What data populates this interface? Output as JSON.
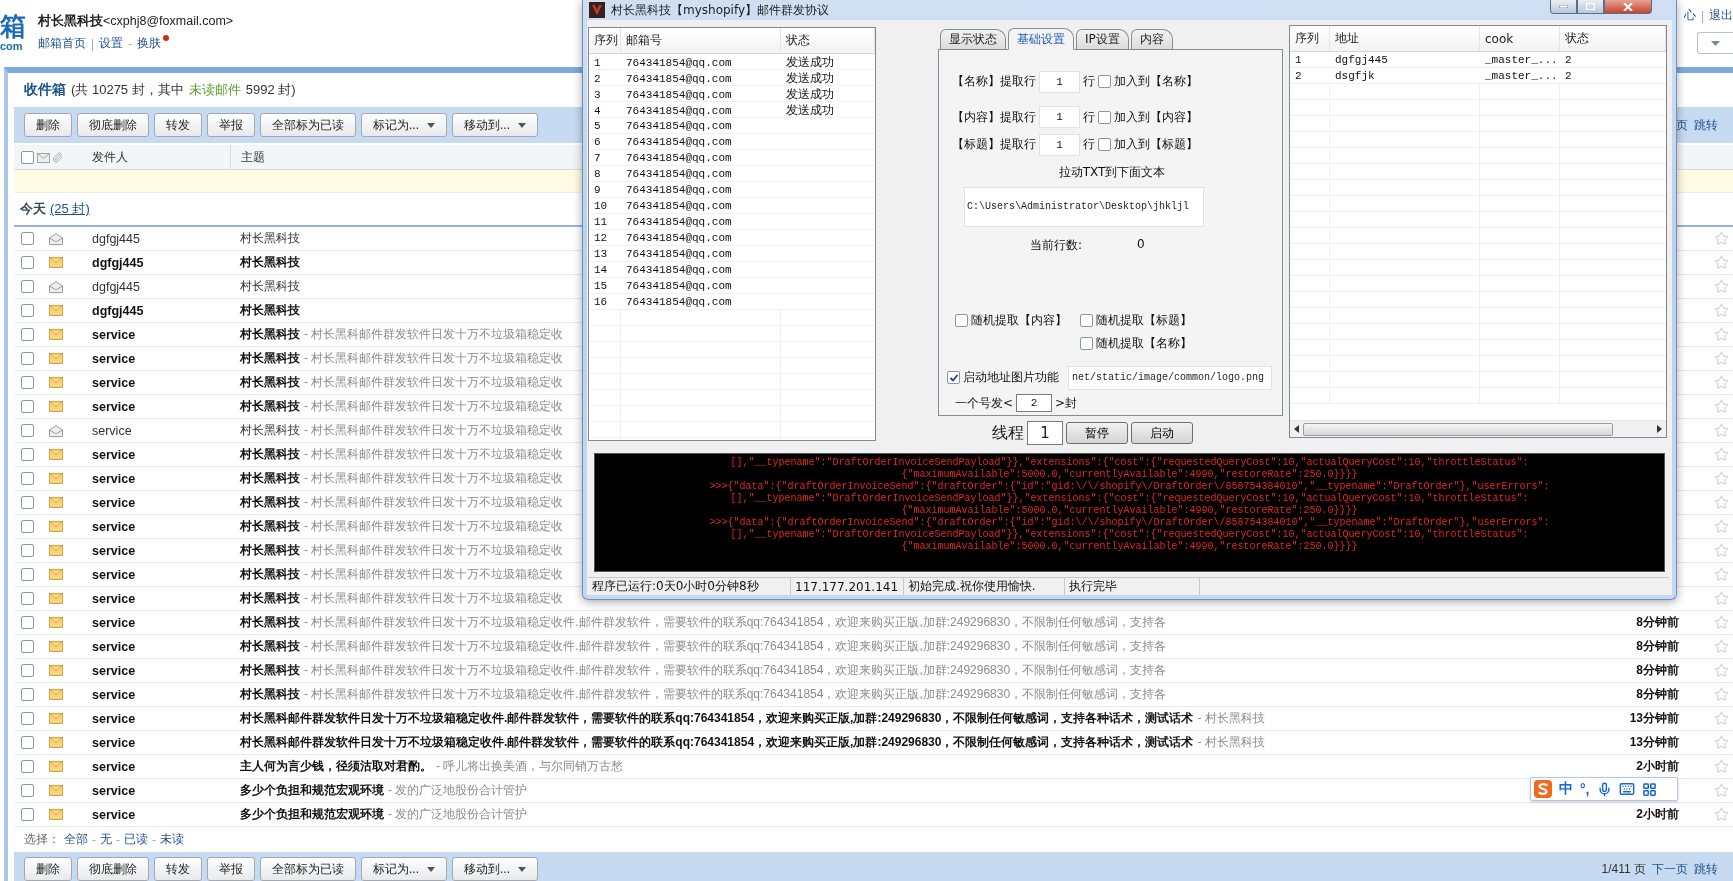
{
  "mail": {
    "logo": "箱",
    "logo_sub": "com",
    "user": "**村长黑科技**<cxphj8@foxmail.com>",
    "header_links": [
      {
        "kind": "link",
        "text": "邮箱首页"
      },
      {
        "kind": "separator",
        "text": "|"
      },
      {
        "kind": "link",
        "text": "设置"
      },
      {
        "kind": "separator",
        "text": "-"
      },
      {
        "kind": "link",
        "text": "换肤",
        "dot": true
      }
    ],
    "top_right_links": [
      {
        "kind": "link",
        "text": "心"
      },
      {
        "kind": "separator",
        "text": "|"
      },
      {
        "kind": "link",
        "text": "退出"
      }
    ],
    "folder": {
      "name": "收件箱",
      "before": "(共 10275 封，其中",
      "unread_label": "未读邮件",
      "after": "5992 封)"
    },
    "toolbar": [
      {
        "label": "删除",
        "kind": "button"
      },
      {
        "label": "彻底删除",
        "kind": "button"
      },
      {
        "label": "转发",
        "kind": "button"
      },
      {
        "label": "举报",
        "kind": "button"
      },
      {
        "label": "全部标为已读",
        "kind": "button"
      },
      {
        "label": "标记为...",
        "kind": "menu"
      },
      {
        "label": "移动到...",
        "kind": "menu"
      }
    ],
    "toolbar_links": [
      "页",
      "跳转"
    ],
    "select_all": {
      "checked": false
    },
    "columns": [
      "发件人",
      "主题"
    ],
    "group": {
      "label": "今天",
      "count": "(25 封)"
    },
    "rows": [
      {
        "sender": "dgfgj445",
        "unread": false,
        "checked": false,
        "starred": false,
        "subject": "村长黑科技"
      },
      {
        "sender": "dgfgj445",
        "unread": true,
        "checked": false,
        "starred": false,
        "subject": "村长黑科技"
      },
      {
        "sender": "dgfgj445",
        "unread": false,
        "checked": false,
        "starred": false,
        "subject": "村长黑科技"
      },
      {
        "sender": "dgfgj445",
        "unread": true,
        "checked": false,
        "starred": false,
        "subject": "村长黑科技"
      },
      {
        "sender": "service",
        "unread": true,
        "checked": false,
        "starred": false,
        "subject": "村长黑科技",
        "preview": "- 村长黑科邮件群发软件日发十万不垃圾箱稳定收"
      },
      {
        "sender": "service",
        "unread": true,
        "checked": false,
        "starred": false,
        "subject": "村长黑科技",
        "preview": "- 村长黑科邮件群发软件日发十万不垃圾箱稳定收"
      },
      {
        "sender": "service",
        "unread": true,
        "checked": false,
        "starred": false,
        "subject": "村长黑科技",
        "preview": "- 村长黑科邮件群发软件日发十万不垃圾箱稳定收"
      },
      {
        "sender": "service",
        "unread": true,
        "checked": false,
        "starred": false,
        "subject": "村长黑科技",
        "preview": "- 村长黑科邮件群发软件日发十万不垃圾箱稳定收"
      },
      {
        "sender": "service",
        "unread": false,
        "checked": false,
        "starred": false,
        "subject": "村长黑科技",
        "preview": "- 村长黑科邮件群发软件日发十万不垃圾箱稳定收"
      },
      {
        "sender": "service",
        "unread": true,
        "checked": false,
        "starred": false,
        "subject": "村长黑科技",
        "preview": "- 村长黑科邮件群发软件日发十万不垃圾箱稳定收"
      },
      {
        "sender": "service",
        "unread": true,
        "checked": false,
        "starred": false,
        "subject": "村长黑科技",
        "preview": "- 村长黑科邮件群发软件日发十万不垃圾箱稳定收"
      },
      {
        "sender": "service",
        "unread": true,
        "checked": false,
        "starred": false,
        "subject": "村长黑科技",
        "preview": "- 村长黑科邮件群发软件日发十万不垃圾箱稳定收"
      },
      {
        "sender": "service",
        "unread": true,
        "checked": false,
        "starred": false,
        "subject": "村长黑科技",
        "preview": "- 村长黑科邮件群发软件日发十万不垃圾箱稳定收"
      },
      {
        "sender": "service",
        "unread": true,
        "checked": false,
        "starred": false,
        "subject": "村长黑科技",
        "preview": "- 村长黑科邮件群发软件日发十万不垃圾箱稳定收"
      },
      {
        "sender": "service",
        "unread": true,
        "checked": false,
        "starred": false,
        "subject": "村长黑科技",
        "preview": "- 村长黑科邮件群发软件日发十万不垃圾箱稳定收"
      },
      {
        "sender": "service",
        "unread": true,
        "checked": false,
        "starred": false,
        "subject": "村长黑科技",
        "preview": "- 村长黑科邮件群发软件日发十万不垃圾箱稳定收"
      },
      {
        "sender": "service",
        "unread": true,
        "checked": false,
        "starred": false,
        "subject": "村长黑科技",
        "preview": "- 村长黑科邮件群发软件日发十万不垃圾箱稳定收件.邮件群发软件，需要软件的联系qq:764341854，欢迎来购买正版,加群:249296830，不限制任何敏感词，支持各",
        "time": "8分钟前"
      },
      {
        "sender": "service",
        "unread": true,
        "checked": false,
        "starred": false,
        "subject": "村长黑科技",
        "preview": "- 村长黑科邮件群发软件日发十万不垃圾箱稳定收件.邮件群发软件，需要软件的联系qq:764341854，欢迎来购买正版,加群:249296830，不限制任何敏感词，支持各",
        "time": "8分钟前"
      },
      {
        "sender": "service",
        "unread": true,
        "checked": false,
        "starred": false,
        "subject": "村长黑科技",
        "preview": "- 村长黑科邮件群发软件日发十万不垃圾箱稳定收件.邮件群发软件，需要软件的联系qq:764341854，欢迎来购买正版,加群:249296830，不限制任何敏感词，支持各",
        "time": "8分钟前"
      },
      {
        "sender": "service",
        "unread": true,
        "checked": false,
        "starred": false,
        "subject": "村长黑科技",
        "preview": "- 村长黑科邮件群发软件日发十万不垃圾箱稳定收件.邮件群发软件，需要软件的联系qq:764341854，欢迎来购买正版,加群:249296830，不限制任何敏感词，支持各",
        "time": "8分钟前"
      },
      {
        "sender": "service",
        "unread": true,
        "checked": false,
        "starred": false,
        "subject": "村长黑科邮件群发软件日发十万不垃圾箱稳定收件.邮件群发软件，需要软件的联系qq:764341854，欢迎来购买正版,加群:249296830，不限制任何敏感词，支持各种话术，测试话术",
        "preview": "- 村长黑科技",
        "time": "13分钟前"
      },
      {
        "sender": "service",
        "unread": true,
        "checked": false,
        "starred": false,
        "subject": "村长黑科邮件群发软件日发十万不垃圾箱稳定收件.邮件群发软件，需要软件的联系qq:764341854，欢迎来购买正版,加群:249296830，不限制任何敏感词，支持各种话术，测试话术",
        "preview": "- 村长黑科技",
        "time": "13分钟前"
      },
      {
        "sender": "service",
        "unread": true,
        "checked": false,
        "starred": false,
        "subject": "主人何为言少钱，径须沽取对君酌。",
        "preview": "- 呼儿将出换美酒，与尔同销万古愁",
        "time": "2小时前"
      },
      {
        "sender": "service",
        "unread": true,
        "checked": false,
        "starred": false,
        "subject": "多少个负担和规范宏观环境",
        "preview": "- 发的广泛地股份合计管护"
      },
      {
        "sender": "service",
        "unread": true,
        "checked": false,
        "starred": false,
        "subject": "多少个负担和规范宏观环境",
        "preview": "- 发的广泛地股份合计管护",
        "time": "2小时前"
      }
    ],
    "select": {
      "label": "选择：",
      "options": [
        "全部",
        "无",
        "已读",
        "未读"
      ],
      "separator": "-"
    },
    "bottom_toolbar": [
      {
        "label": "删除",
        "kind": "button"
      },
      {
        "label": "彻底删除",
        "kind": "button"
      },
      {
        "label": "转发",
        "kind": "button"
      },
      {
        "label": "举报",
        "kind": "button"
      },
      {
        "label": "全部标为已读",
        "kind": "button"
      },
      {
        "label": "标记为...",
        "kind": "menu"
      },
      {
        "label": "移动到...",
        "kind": "menu"
      }
    ],
    "pager": {
      "page": "1/411 页",
      "links": [
        "下一页",
        "跳转"
      ]
    }
  },
  "app": {
    "title": "村长黑科技【myshopify】邮件群发协议",
    "email_table": {
      "columns": [
        "序列",
        "邮箱号",
        "状态"
      ],
      "rows": [
        {
          "index": "1",
          "email": "764341854@qq.com",
          "status": "发送成功"
        },
        {
          "index": "2",
          "email": "764341854@qq.com",
          "status": "发送成功"
        },
        {
          "index": "3",
          "email": "764341854@qq.com",
          "status": "发送成功"
        },
        {
          "index": "4",
          "email": "764341854@qq.com",
          "status": "发送成功"
        },
        {
          "index": "5",
          "email": "764341854@qq.com"
        },
        {
          "index": "6",
          "email": "764341854@qq.com"
        },
        {
          "index": "7",
          "email": "764341854@qq.com"
        },
        {
          "index": "8",
          "email": "764341854@qq.com"
        },
        {
          "index": "9",
          "email": "764341854@qq.com"
        },
        {
          "index": "10",
          "email": "764341854@qq.com"
        },
        {
          "index": "11",
          "email": "764341854@qq.com"
        },
        {
          "index": "12",
          "email": "764341854@qq.com"
        },
        {
          "index": "13",
          "email": "764341854@qq.com"
        },
        {
          "index": "14",
          "email": "764341854@qq.com"
        },
        {
          "index": "15",
          "email": "764341854@qq.com"
        },
        {
          "index": "16",
          "email": "764341854@qq.com"
        }
      ]
    },
    "tabs": [
      {
        "label": "显示状态",
        "selected": false
      },
      {
        "label": "基础设置",
        "selected": true
      },
      {
        "label": "IP设置",
        "selected": false
      },
      {
        "label": "内容",
        "selected": false
      }
    ],
    "extract_rows": [
      {
        "label": "【名称】提取行",
        "value": "1",
        "unit": "行",
        "checkbox_label": "加入到【名称】",
        "checked": false
      },
      {
        "label": "【内容】提取行",
        "value": "1",
        "unit": "行",
        "checkbox_label": "加入到【内容】",
        "checked": false
      },
      {
        "label": "【标题】提取行",
        "value": "1",
        "unit": "行",
        "checkbox_label": "加入到【标题】",
        "checked": false
      }
    ],
    "drag_hint": "拉动TXT到下面文本",
    "path": "C:\\Users\\Administrator\\Desktop\\jhkljl",
    "line_count_label": "当前行数:",
    "line_count": "0",
    "random_options": [
      {
        "label": "随机提取【内容】",
        "checked": false
      },
      {
        "label": "随机提取【标题】",
        "checked": false
      },
      {
        "label": "随机提取【名称】",
        "checked": false
      }
    ],
    "image_feature": {
      "label": "启动地址图片功能",
      "checked": true,
      "value": "net/static/image/common/logo.png"
    },
    "per_account": {
      "prefix": "一个号发<",
      "value": "2",
      "suffix": ">封"
    },
    "thread": {
      "label": "线程",
      "value": "1"
    },
    "buttons": [
      "暂停",
      "启动"
    ],
    "account_table": {
      "columns": [
        "序列",
        "地址",
        "cook",
        "状态"
      ],
      "rows": [
        {
          "index": "1",
          "address": "dgfgj445",
          "cook": "_master_...",
          "status": "2"
        },
        {
          "index": "2",
          "address": "dsgfjk",
          "cook": "_master_...",
          "status": "2"
        }
      ]
    },
    "console_lines": [
      "[],\"__typename\":\"DraftOrderInvoiceSendPayload\"}},\"extensions\":{\"cost\":{\"requestedQueryCost\":10,\"actualQueryCost\":10,\"throttleStatus\":",
      "{\"maximumAvailable\":5000.0,\"currentlyAvailable\":4990,\"restoreRate\":250.0}}}}",
      ">>>{\"data\":{\"draftOrderInvoiceSend\":{\"draftOrder\":{\"id\":\"gid:\\/\\/shopify\\/DraftOrder\\/858754384010\",\"__typename\":\"DraftOrder\"},\"userErrors\":",
      "[],\"__typename\":\"DraftOrderInvoiceSendPayload\"}},\"extensions\":{\"cost\":{\"requestedQueryCost\":10,\"actualQueryCost\":10,\"throttleStatus\":",
      "{\"maximumAvailable\":5000.0,\"currentlyAvailable\":4990,\"restoreRate\":250.0}}}}",
      ">>>{\"data\":{\"draftOrderInvoiceSend\":{\"draftOrder\":{\"id\":\"gid:\\/\\/shopify\\/DraftOrder\\/858754384010\",\"__typename\":\"DraftOrder\"},\"userErrors\":",
      "[],\"__typename\":\"DraftOrderInvoiceSendPayload\"}},\"extensions\":{\"cost\":{\"requestedQueryCost\":10,\"actualQueryCost\":10,\"throttleStatus\":",
      "{\"maximumAvailable\":5000.0,\"currentlyAvailable\":4990,\"restoreRate\":250.0}}}}"
    ],
    "status_bar": [
      "程序已运行:0天0小时0分钟8秒",
      "117.177.201.141",
      "初始完成.祝你使用愉快.",
      "执行完毕"
    ]
  },
  "ime": {
    "mode": "中",
    "punct": "°,"
  }
}
